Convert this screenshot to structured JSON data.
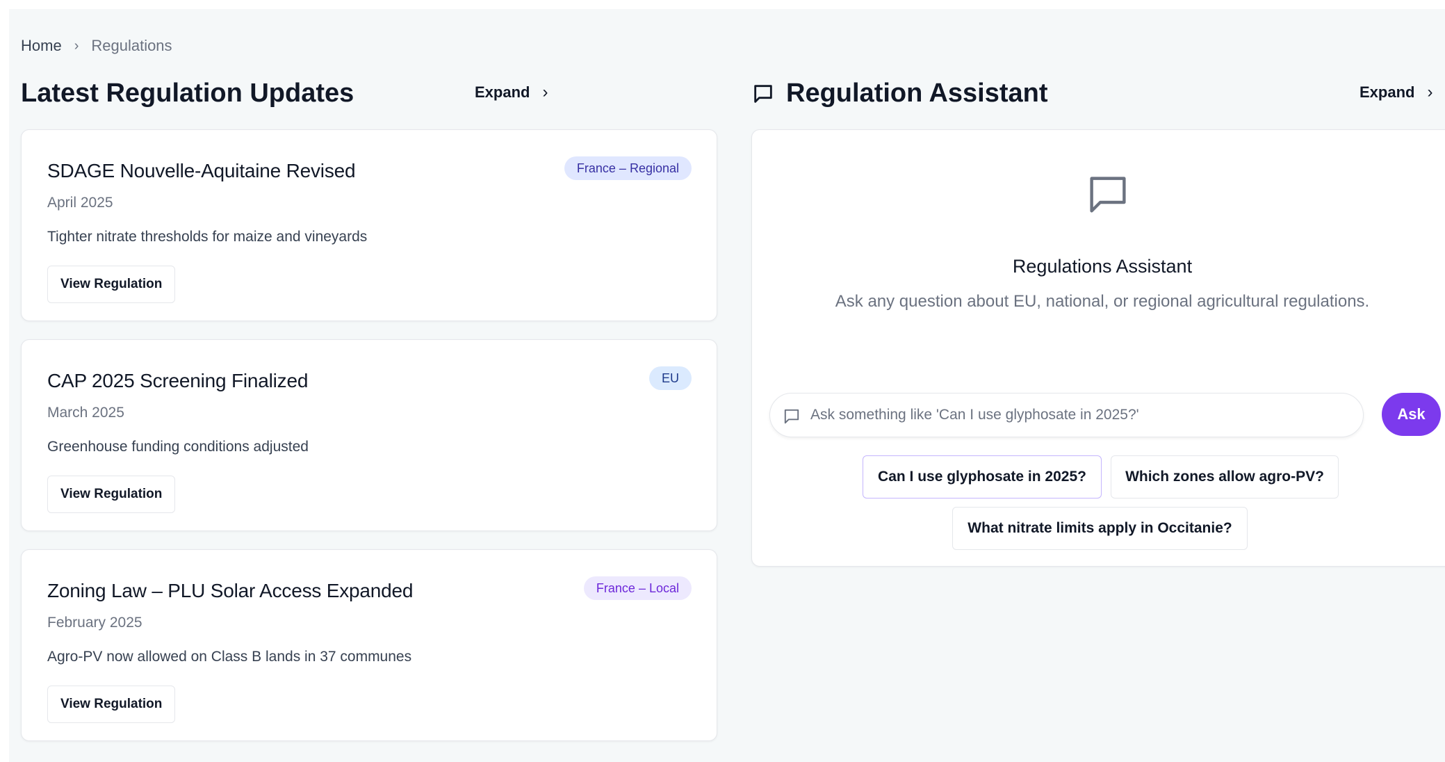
{
  "breadcrumb": {
    "home": "Home",
    "separator": "›",
    "current": "Regulations"
  },
  "updates_panel": {
    "title": "Latest Regulation Updates",
    "expand_label": "Expand",
    "expand_chevron": "›",
    "cards": [
      {
        "title": "SDAGE Nouvelle-Aquitaine Revised",
        "date": "April 2025",
        "description": "Tighter nitrate thresholds for maize and vineyards",
        "badge": "France – Regional",
        "button": "View Regulation"
      },
      {
        "title": "CAP 2025 Screening Finalized",
        "date": "March 2025",
        "description": "Greenhouse funding conditions adjusted",
        "badge": "EU",
        "button": "View Regulation"
      },
      {
        "title": "Zoning Law – PLU Solar Access Expanded",
        "date": "February 2025",
        "description": "Agro-PV now allowed on Class B lands in 37 communes",
        "badge": "France – Local",
        "button": "View Regulation"
      }
    ]
  },
  "assistant_panel": {
    "title": "Regulation Assistant",
    "title_icon": "chat-bubble-icon",
    "expand_label": "Expand",
    "expand_chevron": "›",
    "heading": "Regulations Assistant",
    "subheading": "Ask any question about EU, national, or regional agricultural regulations.",
    "input_placeholder": "Ask something like 'Can I use glyphosate in 2025?'",
    "input_value": "",
    "ask_button": "Ask",
    "suggestions": [
      "Can I use glyphosate in 2025?",
      "Which zones allow agro-PV?",
      "What nitrate limits apply in Occitanie?"
    ]
  },
  "colors": {
    "background": "#f5f8f9",
    "accent": "#7c3aed",
    "badge_regional_bg": "#e0e7ff",
    "badge_eu_bg": "#dbeafe",
    "badge_local_bg": "#ede9fe"
  }
}
